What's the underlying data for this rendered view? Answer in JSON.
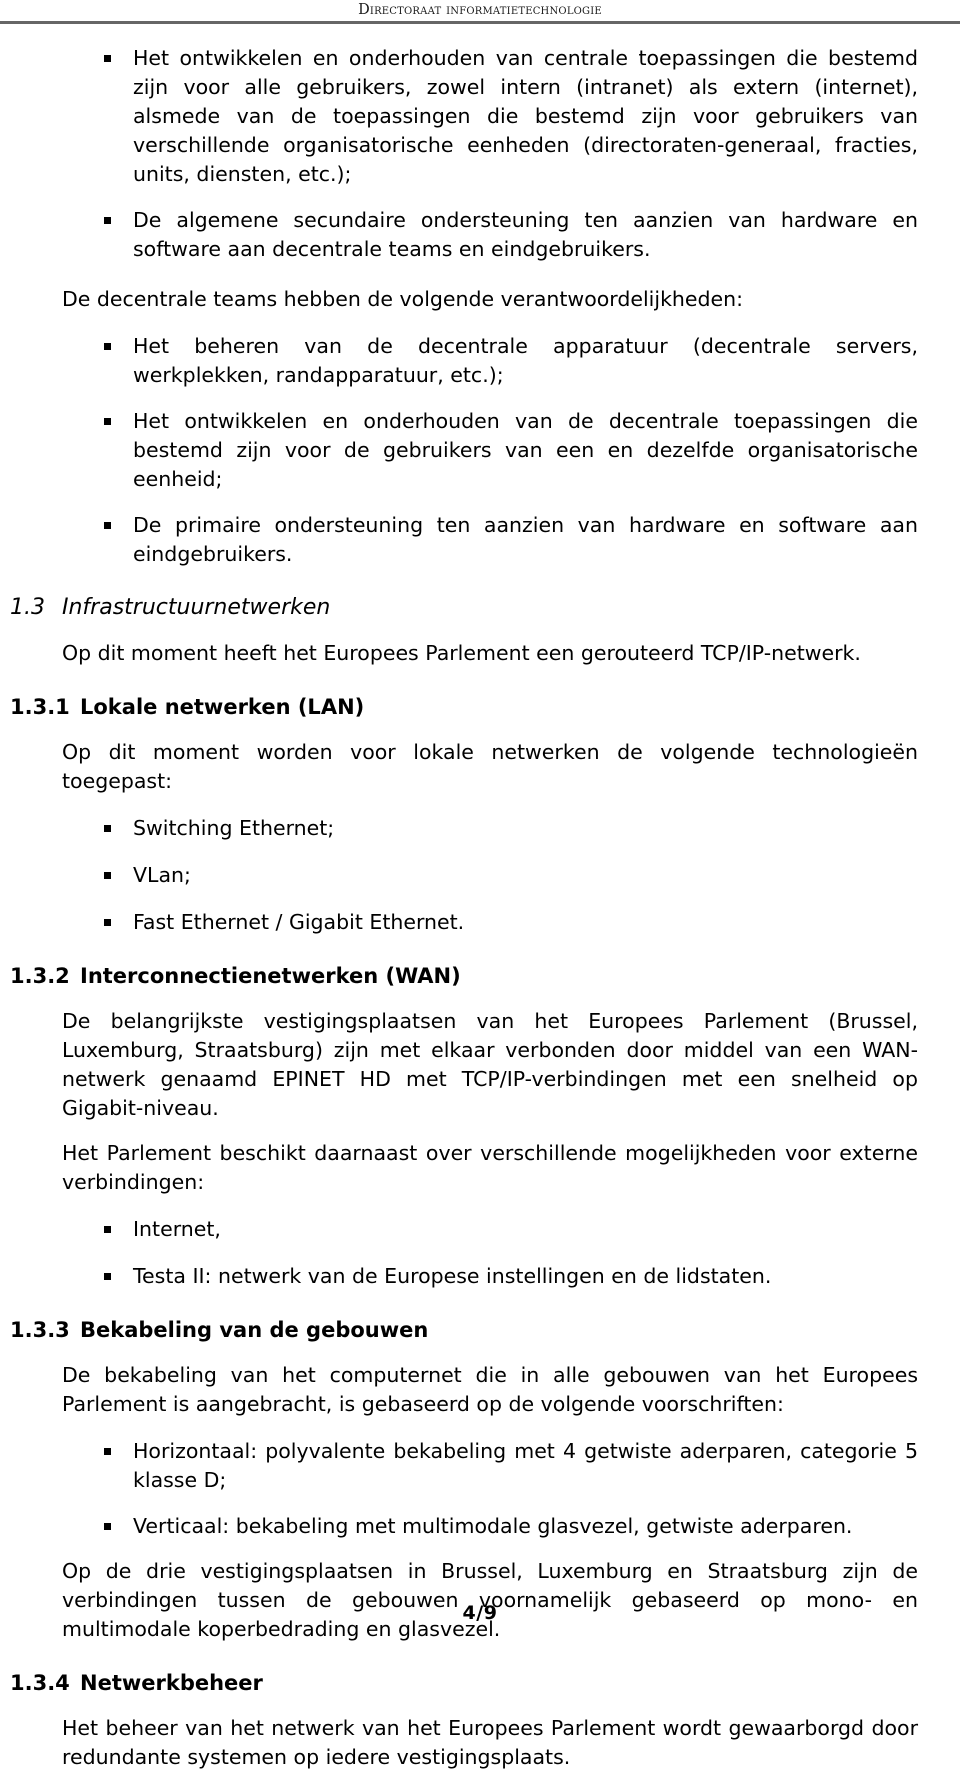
{
  "header": {
    "title": "Directoraat informatietechnologie"
  },
  "body": {
    "intro_bullets": [
      "Het ontwikkelen en onderhouden van centrale toepassingen die bestemd zijn voor alle gebruikers, zowel intern (intranet) als extern (internet), alsmede van de toepassingen die bestemd zijn voor gebruikers van verschillende organisatorische eenheden (directoraten-generaal, fracties, units, diensten, etc.);",
      "De algemene secundaire ondersteuning ten aanzien van hardware en software aan decentrale teams en eindgebruikers."
    ],
    "decentrale_intro": "De decentrale teams hebben de volgende verantwoordelijkheden:",
    "decentrale_bullets": [
      "Het beheren van de decentrale apparatuur (decentrale servers, werkplekken, randapparatuur, etc.);",
      "Het ontwikkelen en onderhouden van de decentrale toepassingen die bestemd zijn voor de gebruikers van een en dezelfde organisatorische eenheid;",
      "De primaire ondersteuning ten aanzien van hardware en software aan eindgebruikers."
    ]
  },
  "sections": {
    "s13": {
      "number": "1.3",
      "title": "Infrastructuurnetwerken",
      "paragraph": "Op dit moment heeft het Europees Parlement een gerouteerd TCP/IP-netwerk."
    },
    "s131": {
      "number": "1.3.1",
      "title": "Lokale netwerken (LAN)",
      "paragraph": "Op dit moment worden voor lokale netwerken de volgende technologieën toegepast:",
      "bullets": [
        "Switching Ethernet;",
        "VLan;",
        "Fast Ethernet / Gigabit Ethernet."
      ]
    },
    "s132": {
      "number": "1.3.2",
      "title": "Interconnectienetwerken (WAN)",
      "paragraph1": "De belangrijkste vestigingsplaatsen van het Europees Parlement (Brussel, Luxemburg, Straatsburg) zijn met elkaar verbonden door middel van een WAN-netwerk genaamd EPINET HD met TCP/IP-verbindingen met een snelheid op Gigabit-niveau.",
      "paragraph2": "Het Parlement beschikt daarnaast over verschillende mogelijkheden voor externe verbindingen:",
      "bullets": [
        "Internet,",
        "Testa II: netwerk van de Europese instellingen en de lidstaten."
      ]
    },
    "s133": {
      "number": "1.3.3",
      "title": "Bekabeling van de gebouwen",
      "paragraph1": "De bekabeling van het computernet die in alle gebouwen van het Europees Parlement is aangebracht, is gebaseerd op de volgende voorschriften:",
      "bullets": [
        "Horizontaal: polyvalente bekabeling met 4 getwiste aderparen, categorie 5 klasse D;",
        "Verticaal: bekabeling met multimodale glasvezel, getwiste aderparen."
      ],
      "paragraph2": "Op de drie vestigingsplaatsen in Brussel, Luxemburg en Straatsburg zijn de verbindingen tussen de gebouwen voornamelijk gebaseerd op mono- en multimodale koperbedrading en glasvezel."
    },
    "s134": {
      "number": "1.3.4",
      "title": "Netwerkbeheer",
      "paragraph": "Het beheer van het netwerk van het Europees Parlement wordt gewaarborgd door redundante systemen op iedere vestigingsplaats."
    }
  },
  "footer": {
    "page_number": "4/9"
  }
}
